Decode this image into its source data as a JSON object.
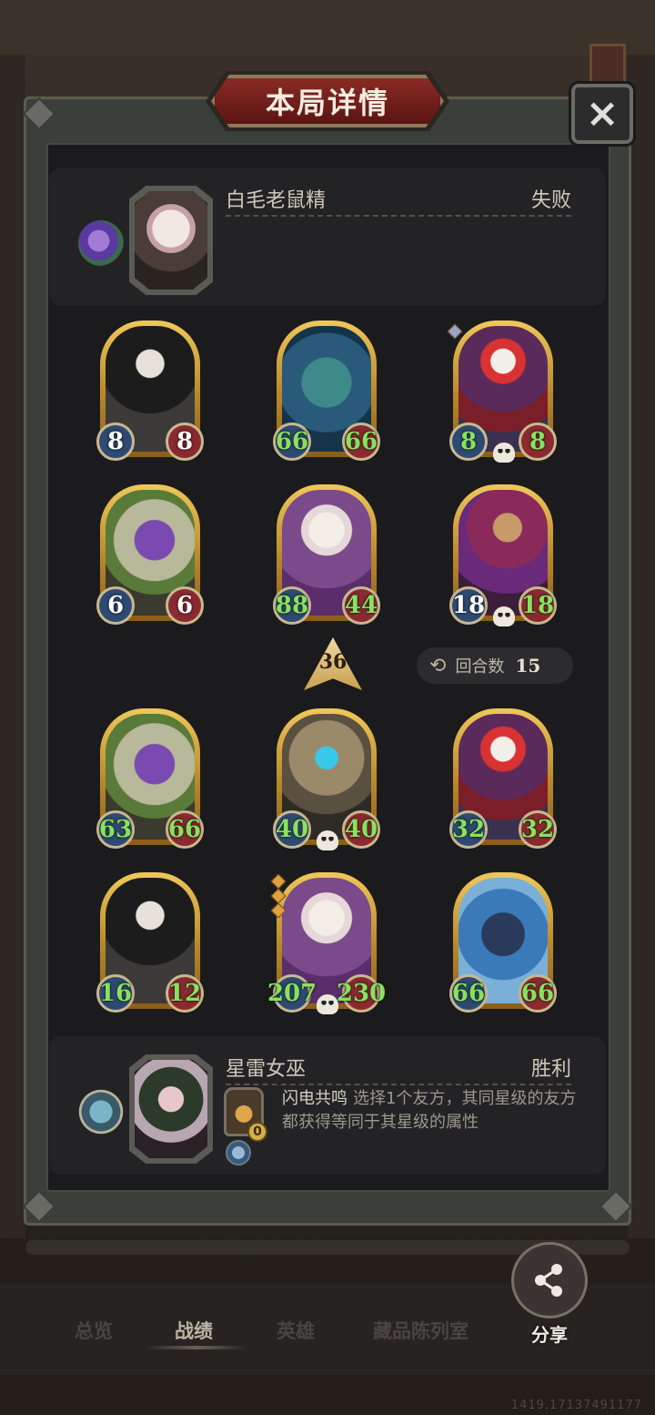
{
  "title": "本局详情",
  "close_icon": "×",
  "opponent": {
    "hero_name": "白毛老鼠精",
    "result": "失败",
    "token_icon": "purple-orb-icon"
  },
  "opponent_minions": [
    {
      "name": "reaper",
      "atk": "8",
      "hp": "8",
      "atk_color": "white",
      "hp_color": "white"
    },
    {
      "name": "sea-dragon",
      "atk": "66",
      "hp": "66",
      "atk_color": "green",
      "hp_color": "green"
    },
    {
      "name": "clown",
      "atk": "8",
      "hp": "8",
      "atk_color": "green",
      "hp_color": "green",
      "skull": true
    },
    {
      "name": "snake",
      "atk": "6",
      "hp": "6",
      "atk_color": "white",
      "hp_color": "white"
    },
    {
      "name": "white-rat",
      "atk": "88",
      "hp": "44",
      "atk_color": "green",
      "hp_color": "green"
    },
    {
      "name": "pirate",
      "atk": "18",
      "hp": "18",
      "atk_color": "white",
      "hp_color": "green",
      "skull": true
    }
  ],
  "tavern_tier": "36",
  "round": {
    "label": "回合数",
    "value": "15"
  },
  "player_minions": [
    {
      "name": "snake",
      "atk": "63",
      "hp": "66",
      "atk_color": "green",
      "hp_color": "green"
    },
    {
      "name": "demon",
      "atk": "40",
      "hp": "40",
      "atk_color": "green",
      "hp_color": "green",
      "skull": true
    },
    {
      "name": "clown",
      "atk": "32",
      "hp": "32",
      "atk_color": "green",
      "hp_color": "green"
    },
    {
      "name": "reaper",
      "atk": "16",
      "hp": "12",
      "atk_color": "green",
      "hp_color": "green"
    },
    {
      "name": "white-rat",
      "atk": "207",
      "hp": "230",
      "atk_color": "green",
      "hp_color": "green",
      "skull": true
    },
    {
      "name": "blue-dragon",
      "atk": "66",
      "hp": "66",
      "atk_color": "green",
      "hp_color": "green"
    }
  ],
  "player": {
    "hero_name": "星雷女巫",
    "result": "胜利",
    "skill_name": "闪电共鸣",
    "skill_desc": "选择1个友方，其同星级的友方都获得等同于其星级的属性",
    "skill_cost": "0"
  },
  "nav": {
    "items": [
      "总览",
      "战绩",
      "英雄",
      "藏品陈列室"
    ],
    "active_index": 1,
    "share_label": "分享"
  },
  "footer_id": "1419.17137491177"
}
